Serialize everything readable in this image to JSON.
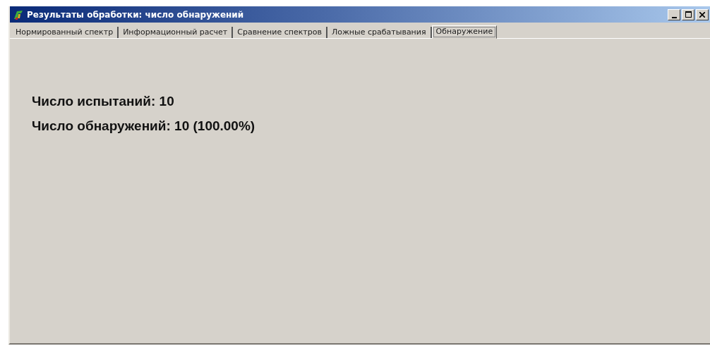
{
  "window": {
    "title": "Результаты обработки: число обнаружений"
  },
  "tabs": [
    {
      "label": "Нормированный спектр",
      "selected": false
    },
    {
      "label": "Информационный расчет",
      "selected": false
    },
    {
      "label": "Сравнение спектров",
      "selected": false
    },
    {
      "label": "Ложные срабатывания",
      "selected": false
    },
    {
      "label": "Обнаружение",
      "selected": true
    }
  ],
  "lines": [
    "Число испытаний: 10",
    "Число обнаружений: 10 (100.00%)"
  ]
}
